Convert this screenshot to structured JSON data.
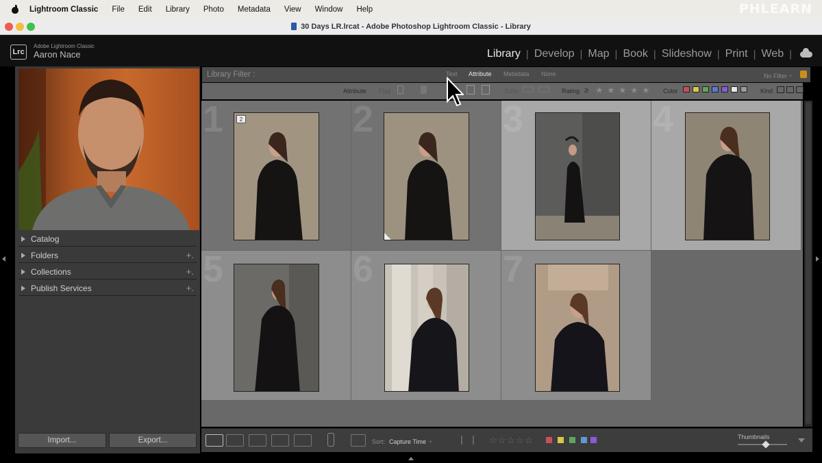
{
  "menubar": {
    "app_name": "Lightroom Classic",
    "items": [
      "File",
      "Edit",
      "Library",
      "Photo",
      "Metadata",
      "View",
      "Window",
      "Help"
    ],
    "watermark": "PHLEARN"
  },
  "window": {
    "title": "30 Days LR.lrcat - Adobe Photoshop Lightroom Classic - Library"
  },
  "identity": {
    "logo": "Lrc",
    "app_subtitle": "Adobe Lightroom Classic",
    "user": "Aaron Nace"
  },
  "modules": {
    "items": [
      "Library",
      "Develop",
      "Map",
      "Book",
      "Slideshow",
      "Print",
      "Web"
    ],
    "active": "Library"
  },
  "left_panel": {
    "sections": [
      {
        "label": "Catalog",
        "has_plus": false
      },
      {
        "label": "Folders",
        "has_plus": true
      },
      {
        "label": "Collections",
        "has_plus": true
      },
      {
        "label": "Publish Services",
        "has_plus": true
      }
    ],
    "plus_symbol": "+.",
    "import_label": "Import...",
    "export_label": "Export..."
  },
  "filter_bar": {
    "label": "Library Filter :",
    "tabs": [
      "Text",
      "Attribute",
      "Metadata",
      "None"
    ],
    "active_tab": "Attribute",
    "preset": "No Filter ÷",
    "attribute_row": {
      "attribute": "Attribute",
      "flag": "Flag",
      "edits": "Edits",
      "rating": "Rating",
      "rating_op": "≥",
      "color": "Color",
      "kind": "Kind"
    },
    "color_swatches": [
      "#c8505a",
      "#d6c94a",
      "#5aa85a",
      "#5a7ad6",
      "#8c5ad6",
      "#e8e8e8",
      "#9a9a9a"
    ]
  },
  "grid": {
    "cells": [
      {
        "num": "1",
        "selected": false,
        "dim": true,
        "badge": "2",
        "corner": false,
        "photo": "woman-black-coat-stone-wall"
      },
      {
        "num": "2",
        "selected": false,
        "dim": true,
        "badge": "",
        "corner": true,
        "photo": "woman-black-coat-stone-wall"
      },
      {
        "num": "3",
        "selected": true,
        "dim": false,
        "badge": "",
        "corner": false,
        "photo": "woman-posing-grey-wall"
      },
      {
        "num": "4",
        "selected": true,
        "dim": false,
        "badge": "",
        "corner": false,
        "photo": "woman-black-blazer-wall"
      },
      {
        "num": "5",
        "selected": false,
        "dim": false,
        "badge": "",
        "corner": false,
        "photo": "woman-long-coat-wall"
      },
      {
        "num": "6",
        "selected": false,
        "dim": false,
        "badge": "",
        "corner": false,
        "photo": "woman-by-columns"
      },
      {
        "num": "7",
        "selected": false,
        "dim": false,
        "badge": "",
        "corner": false,
        "photo": "woman-seated-steps"
      }
    ]
  },
  "toolbar": {
    "sort_label": "Sort:",
    "sort_value": "Capture Time",
    "sort_arrows": "÷",
    "thumbnails_label": "Thumbnails",
    "label_colors": [
      "#c8505a",
      "#d6c94a",
      "#5aa85a",
      "#5a9ad6",
      "#8c5ad6"
    ]
  },
  "colors": {
    "accent_lock": "#c98f1d"
  }
}
